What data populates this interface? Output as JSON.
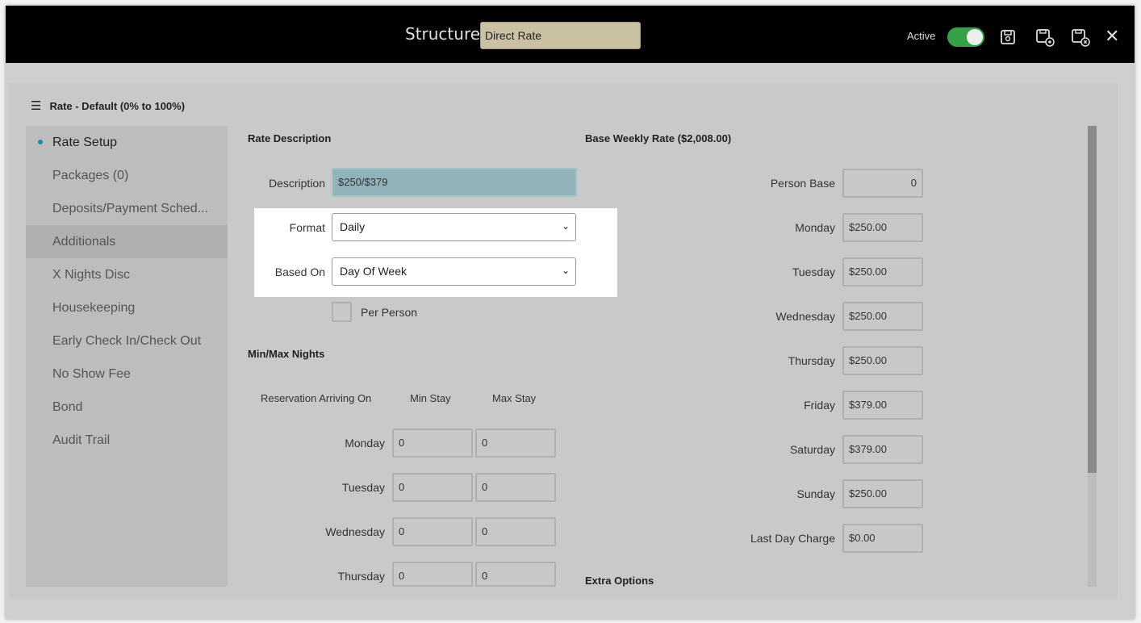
{
  "topbar": {
    "structure_label": "Structure",
    "structure_value": "Direct Rate",
    "active_label": "Active",
    "active_on": true
  },
  "panel": {
    "header": "Rate - Default (0% to 100%)"
  },
  "sidebar": {
    "items": [
      {
        "label": "Rate Setup"
      },
      {
        "label": "Packages (0)"
      },
      {
        "label": "Deposits/Payment Sched..."
      },
      {
        "label": "Additionals"
      },
      {
        "label": "X Nights Disc"
      },
      {
        "label": "Housekeeping"
      },
      {
        "label": "Early Check In/Check Out"
      },
      {
        "label": "No Show Fee"
      },
      {
        "label": "Bond"
      },
      {
        "label": "Audit Trail"
      }
    ]
  },
  "rate_description": {
    "title": "Rate Description",
    "description_label": "Description",
    "description_value": "$250/$379",
    "format_label": "Format",
    "format_value": "Daily",
    "based_on_label": "Based On",
    "based_on_value": "Day Of Week",
    "per_person_label": "Per Person"
  },
  "min_max": {
    "title": "Min/Max Nights",
    "col_arriving": "Reservation Arriving On",
    "col_min": "Min Stay",
    "col_max": "Max Stay",
    "rows": [
      {
        "day": "Monday",
        "min": "0",
        "max": "0"
      },
      {
        "day": "Tuesday",
        "min": "0",
        "max": "0"
      },
      {
        "day": "Wednesday",
        "min": "0",
        "max": "0"
      },
      {
        "day": "Thursday",
        "min": "0",
        "max": "0"
      }
    ]
  },
  "base_weekly": {
    "title": "Base Weekly Rate ($2,008.00)",
    "person_base_label": "Person Base",
    "person_base_value": "0",
    "rows": [
      {
        "day": "Monday",
        "value": "$250.00"
      },
      {
        "day": "Tuesday",
        "value": "$250.00"
      },
      {
        "day": "Wednesday",
        "value": "$250.00"
      },
      {
        "day": "Thursday",
        "value": "$250.00"
      },
      {
        "day": "Friday",
        "value": "$379.00"
      },
      {
        "day": "Saturday",
        "value": "$379.00"
      },
      {
        "day": "Sunday",
        "value": "$250.00"
      },
      {
        "day": "Last Day Charge",
        "value": "$0.00"
      }
    ]
  },
  "extra_options": {
    "title": "Extra Options"
  },
  "colors": {
    "topbar_bg": "#000000",
    "toggle_on": "#35a24a",
    "active_dot": "#1a8ca5",
    "description_field": "#8fb3b8",
    "structure_field": "#c9c1a1"
  }
}
